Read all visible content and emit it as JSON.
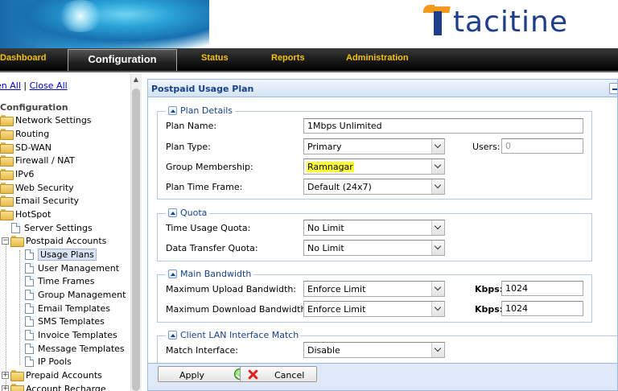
{
  "brand": {
    "logo_text": "tacitine"
  },
  "nav": {
    "dashboard": "Dashboard",
    "configuration": "Configuration",
    "status": "Status",
    "reports": "Reports",
    "administration": "Administration"
  },
  "sidebar": {
    "open_all": "en All",
    "separator": "|",
    "close_all": "Close All",
    "title": "Configuration",
    "items": [
      {
        "label": "Network Settings"
      },
      {
        "label": "Routing"
      },
      {
        "label": "SD-WAN"
      },
      {
        "label": "Firewall / NAT"
      },
      {
        "label": "IPv6"
      },
      {
        "label": "Web Security"
      },
      {
        "label": "Email Security"
      },
      {
        "label": "HotSpot"
      },
      {
        "label": "Server Settings"
      },
      {
        "label": "Postpaid Accounts"
      },
      {
        "label": "Usage Plans"
      },
      {
        "label": "User Management"
      },
      {
        "label": "Time Frames"
      },
      {
        "label": "Group Management"
      },
      {
        "label": "Email Templates"
      },
      {
        "label": "SMS Templates"
      },
      {
        "label": "Invoice Templates"
      },
      {
        "label": "Message Templates"
      },
      {
        "label": "IP Pools"
      },
      {
        "label": "Prepaid Accounts"
      },
      {
        "label": "Account Recharge"
      }
    ],
    "expander_collapsed": "+",
    "expander_expanded": "−"
  },
  "panel": {
    "title": "Postpaid Usage Plan",
    "plan_details": {
      "legend": "Plan Details",
      "plan_name_label": "Plan Name:",
      "plan_name_value": "1Mbps Unlimited",
      "plan_type_label": "Plan Type:",
      "plan_type_value": "Primary",
      "users_label": "Users:",
      "users_value": "0",
      "group_label": "Group Membership:",
      "group_value": "Ramnagar",
      "time_frame_label": "Plan Time Frame:",
      "time_frame_value": "Default (24x7)"
    },
    "quota": {
      "legend": "Quota",
      "time_label": "Time Usage Quota:",
      "time_value": "No Limit",
      "data_label": "Data Transfer Quota:",
      "data_value": "No Limit"
    },
    "bandwidth": {
      "legend": "Main Bandwidth",
      "upload_label": "Maximum Upload Bandwidth:",
      "upload_value": "Enforce Limit",
      "upload_kbps_label": "Kbps:",
      "upload_kbps_value": "1024",
      "download_label": "Maximum Download Bandwidth:",
      "download_value": "Enforce Limit",
      "download_kbps_label": "Kbps:",
      "download_kbps_value": "1024"
    },
    "lan_match": {
      "legend": "Client LAN Interface Match",
      "match_label": "Match Interface:",
      "match_value": "Disable"
    }
  },
  "footer": {
    "apply_label": "Apply",
    "cancel_label": "Cancel"
  },
  "colors": {
    "nav_text": "#f5c400",
    "panel_title": "#15428b",
    "highlight": "#ffff33"
  }
}
